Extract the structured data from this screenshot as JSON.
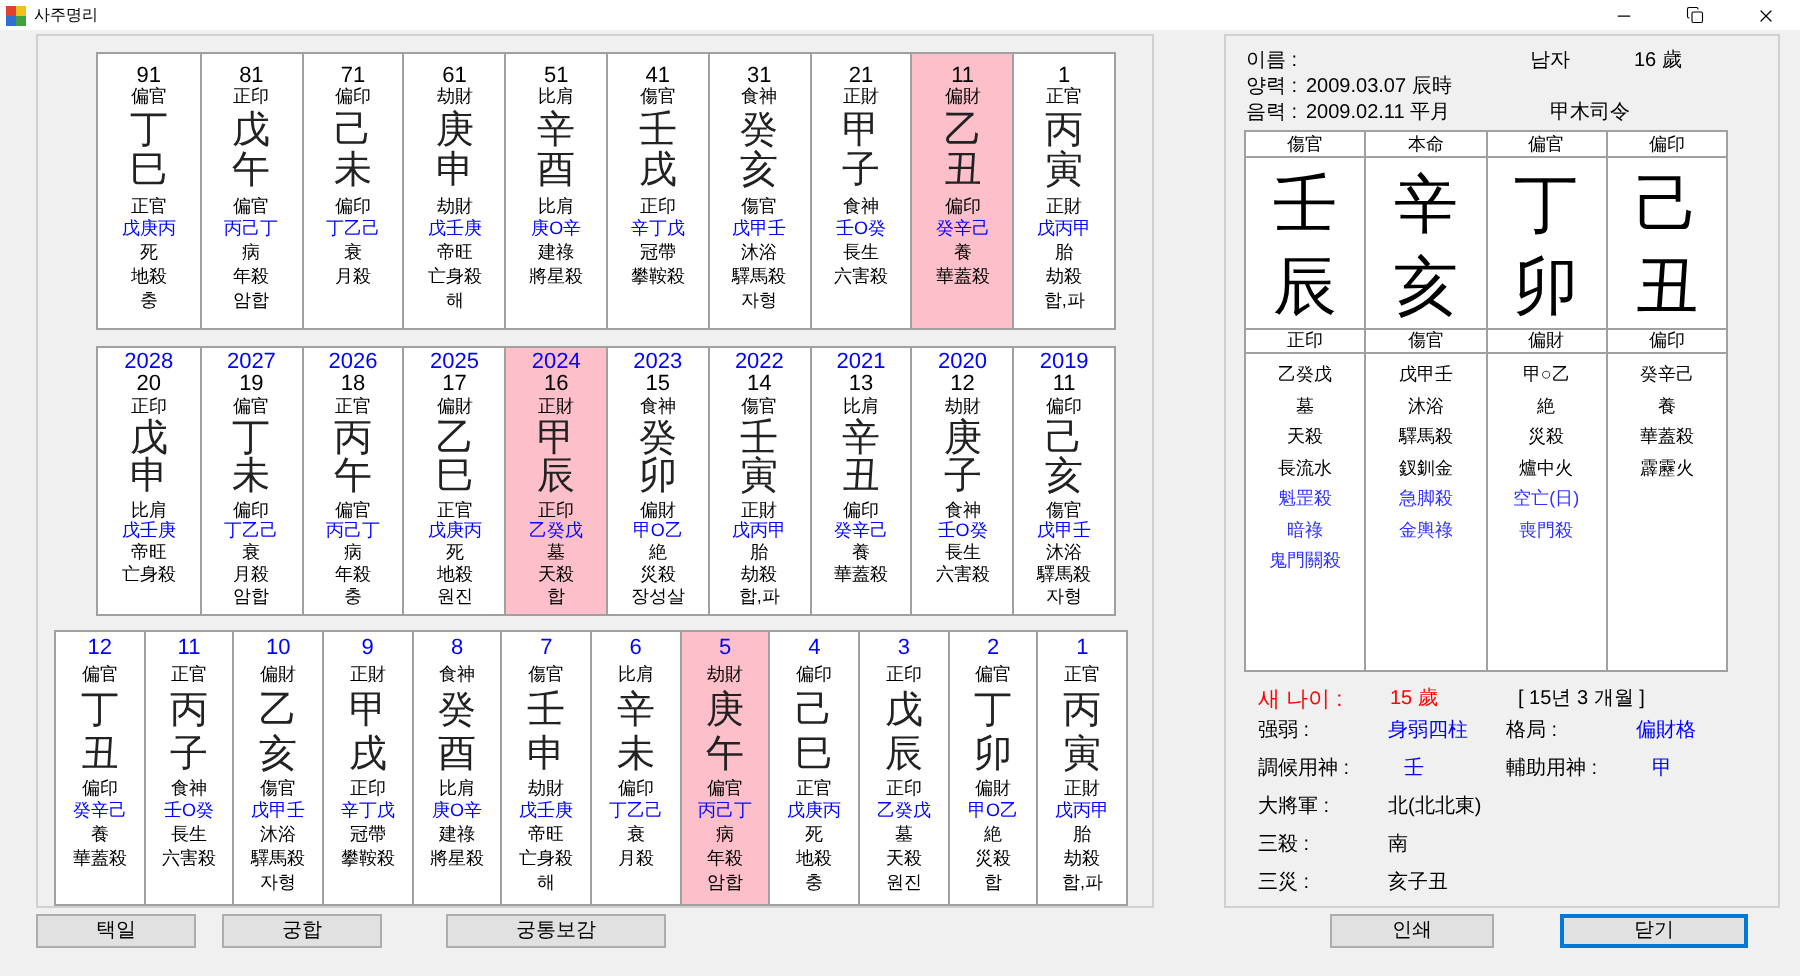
{
  "window": {
    "title": "사주명리"
  },
  "major_luck": [
    {
      "age": "91",
      "god_top": "偏官",
      "stem": "丁",
      "branch": "巳",
      "god_bottom": "正官",
      "hidden": "戊庚丙",
      "stage": "死",
      "sal": "地殺",
      "relation": "충",
      "selected": false
    },
    {
      "age": "81",
      "god_top": "正印",
      "stem": "戊",
      "branch": "午",
      "god_bottom": "偏官",
      "hidden": "丙己丁",
      "stage": "病",
      "sal": "年殺",
      "relation": "암합",
      "selected": false
    },
    {
      "age": "71",
      "god_top": "偏印",
      "stem": "己",
      "branch": "未",
      "god_bottom": "偏印",
      "hidden": "丁乙己",
      "stage": "衰",
      "sal": "月殺",
      "selected": false
    },
    {
      "age": "61",
      "god_top": "劫財",
      "stem": "庚",
      "branch": "申",
      "god_bottom": "劫財",
      "hidden": "戊壬庚",
      "stage": "帝旺",
      "sal": "亡身殺",
      "relation": "해",
      "selected": false
    },
    {
      "age": "51",
      "god_top": "比肩",
      "stem": "辛",
      "branch": "酉",
      "god_bottom": "比肩",
      "hidden": "庚O辛",
      "stage": "建祿",
      "sal": "將星殺",
      "selected": false
    },
    {
      "age": "41",
      "god_top": "傷官",
      "stem": "壬",
      "branch": "戌",
      "god_bottom": "正印",
      "hidden": "辛丁戊",
      "stage": "冠帶",
      "sal": "攀鞍殺",
      "selected": false
    },
    {
      "age": "31",
      "god_top": "食神",
      "stem": "癸",
      "branch": "亥",
      "god_bottom": "傷官",
      "hidden": "戊甲壬",
      "stage": "沐浴",
      "sal": "驛馬殺",
      "relation": "자형",
      "selected": false
    },
    {
      "age": "21",
      "god_top": "正財",
      "stem": "甲",
      "branch": "子",
      "god_bottom": "食神",
      "hidden": "壬O癸",
      "stage": "長生",
      "sal": "六害殺",
      "selected": false
    },
    {
      "age": "11",
      "god_top": "偏財",
      "stem": "乙",
      "branch": "丑",
      "god_bottom": "偏印",
      "hidden": "癸辛己",
      "stage": "養",
      "sal": "華蓋殺",
      "selected": true
    },
    {
      "age": "1",
      "god_top": "正官",
      "stem": "丙",
      "branch": "寅",
      "god_bottom": "正財",
      "hidden": "戊丙甲",
      "stage": "胎",
      "sal": "劫殺",
      "relation": "합,파",
      "selected": false
    }
  ],
  "yearly_luck": [
    {
      "year": "2028",
      "age": "20",
      "god_top": "正印",
      "stem": "戊",
      "branch": "申",
      "god_bottom": "比肩",
      "hidden": "戊壬庚",
      "stage": "帝旺",
      "sal": "亡身殺",
      "selected": false
    },
    {
      "year": "2027",
      "age": "19",
      "god_top": "偏官",
      "stem": "丁",
      "branch": "未",
      "god_bottom": "偏印",
      "hidden": "丁乙己",
      "stage": "衰",
      "sal": "月殺",
      "relation": "암합",
      "selected": false
    },
    {
      "year": "2026",
      "age": "18",
      "god_top": "正官",
      "stem": "丙",
      "branch": "午",
      "god_bottom": "偏官",
      "hidden": "丙己丁",
      "stage": "病",
      "sal": "年殺",
      "relation": "충",
      "selected": false
    },
    {
      "year": "2025",
      "age": "17",
      "god_top": "偏財",
      "stem": "乙",
      "branch": "巳",
      "god_bottom": "正官",
      "hidden": "戊庚丙",
      "stage": "死",
      "sal": "地殺",
      "relation": "원진",
      "selected": false
    },
    {
      "year": "2024",
      "age": "16",
      "god_top": "正財",
      "stem": "甲",
      "branch": "辰",
      "god_bottom": "正印",
      "hidden": "乙癸戊",
      "stage": "墓",
      "sal": "天殺",
      "relation": "합",
      "selected": true
    },
    {
      "year": "2023",
      "age": "15",
      "god_top": "食神",
      "stem": "癸",
      "branch": "卯",
      "god_bottom": "偏財",
      "hidden": "甲O乙",
      "stage": "絶",
      "sal": "災殺",
      "relation": "장성살",
      "selected": false
    },
    {
      "year": "2022",
      "age": "14",
      "god_top": "傷官",
      "stem": "壬",
      "branch": "寅",
      "god_bottom": "正財",
      "hidden": "戊丙甲",
      "stage": "胎",
      "sal": "劫殺",
      "relation": "합,파",
      "selected": false
    },
    {
      "year": "2021",
      "age": "13",
      "god_top": "比肩",
      "stem": "辛",
      "branch": "丑",
      "god_bottom": "偏印",
      "hidden": "癸辛己",
      "stage": "養",
      "sal": "華蓋殺",
      "selected": false
    },
    {
      "year": "2020",
      "age": "12",
      "god_top": "劫財",
      "stem": "庚",
      "branch": "子",
      "god_bottom": "食神",
      "hidden": "壬O癸",
      "stage": "長生",
      "sal": "六害殺",
      "selected": false
    },
    {
      "year": "2019",
      "age": "11",
      "god_top": "偏印",
      "stem": "己",
      "branch": "亥",
      "god_bottom": "傷官",
      "hidden": "戊甲壬",
      "stage": "沐浴",
      "sal": "驛馬殺",
      "relation": "자형",
      "selected": false
    }
  ],
  "monthly_luck": [
    {
      "month": "12",
      "god_top": "偏官",
      "stem": "丁",
      "branch": "丑",
      "god_bottom": "偏印",
      "hidden": "癸辛己",
      "stage": "養",
      "sal": "華蓋殺",
      "selected": false
    },
    {
      "month": "11",
      "god_top": "正官",
      "stem": "丙",
      "branch": "子",
      "god_bottom": "食神",
      "hidden": "壬O癸",
      "stage": "長生",
      "sal": "六害殺",
      "selected": false
    },
    {
      "month": "10",
      "god_top": "偏財",
      "stem": "乙",
      "branch": "亥",
      "god_bottom": "傷官",
      "hidden": "戊甲壬",
      "stage": "沐浴",
      "sal": "驛馬殺",
      "relation": "자형",
      "selected": false
    },
    {
      "month": "9",
      "god_top": "正財",
      "stem": "甲",
      "branch": "戌",
      "god_bottom": "正印",
      "hidden": "辛丁戊",
      "stage": "冠帶",
      "sal": "攀鞍殺",
      "selected": false
    },
    {
      "month": "8",
      "god_top": "食神",
      "stem": "癸",
      "branch": "酉",
      "god_bottom": "比肩",
      "hidden": "庚O辛",
      "stage": "建祿",
      "sal": "將星殺",
      "selected": false
    },
    {
      "month": "7",
      "god_top": "傷官",
      "stem": "壬",
      "branch": "申",
      "god_bottom": "劫財",
      "hidden": "戊壬庚",
      "stage": "帝旺",
      "sal": "亡身殺",
      "relation": "해",
      "selected": false
    },
    {
      "month": "6",
      "god_top": "比肩",
      "stem": "辛",
      "branch": "未",
      "god_bottom": "偏印",
      "hidden": "丁乙己",
      "stage": "衰",
      "sal": "月殺",
      "selected": false
    },
    {
      "month": "5",
      "god_top": "劫財",
      "stem": "庚",
      "branch": "午",
      "god_bottom": "偏官",
      "hidden": "丙己丁",
      "stage": "病",
      "sal": "年殺",
      "relation": "암합",
      "selected": true
    },
    {
      "month": "4",
      "god_top": "偏印",
      "stem": "己",
      "branch": "巳",
      "god_bottom": "正官",
      "hidden": "戊庚丙",
      "stage": "死",
      "sal": "地殺",
      "relation": "충",
      "selected": false
    },
    {
      "month": "3",
      "god_top": "正印",
      "stem": "戊",
      "branch": "辰",
      "god_bottom": "正印",
      "hidden": "乙癸戊",
      "stage": "墓",
      "sal": "天殺",
      "relation": "원진",
      "selected": false
    },
    {
      "month": "2",
      "god_top": "偏官",
      "stem": "丁",
      "branch": "卯",
      "god_bottom": "偏財",
      "hidden": "甲O乙",
      "stage": "絶",
      "sal": "災殺",
      "relation": "합",
      "selected": false
    },
    {
      "month": "1",
      "god_top": "正官",
      "stem": "丙",
      "branch": "寅",
      "god_bottom": "正財",
      "hidden": "戊丙甲",
      "stage": "胎",
      "sal": "劫殺",
      "relation": "합,파",
      "selected": false
    }
  ],
  "profile": {
    "name_label": "이름 :",
    "gender": "남자",
    "age": "16 歲",
    "solar_label": "양력 :",
    "solar_date": "2009.03.07 辰時",
    "lunar_label": "음력 :",
    "lunar_date": "2009.02.11 平月",
    "commander": "甲木司令"
  },
  "natal_chart": [
    {
      "god_top": "傷官",
      "stem": "壬",
      "branch": "辰",
      "god_bottom": "正印",
      "lines": [
        {
          "text": "乙癸戊",
          "kind": "plain"
        },
        {
          "text": "墓",
          "kind": "plain"
        },
        {
          "text": "天殺",
          "kind": "plain"
        },
        {
          "text": "長流水",
          "kind": "plain"
        },
        {
          "text": "魁罡殺",
          "kind": "special"
        },
        {
          "text": "暗祿",
          "kind": "special"
        },
        {
          "text": "鬼門關殺",
          "kind": "special"
        }
      ]
    },
    {
      "god_top": "本命",
      "stem": "辛",
      "branch": "亥",
      "god_bottom": "傷官",
      "lines": [
        {
          "text": "戊甲壬",
          "kind": "plain"
        },
        {
          "text": "沐浴",
          "kind": "plain"
        },
        {
          "text": "驛馬殺",
          "kind": "plain"
        },
        {
          "text": "釵釧金",
          "kind": "plain"
        },
        {
          "text": "急脚殺",
          "kind": "special"
        },
        {
          "text": "金輿祿",
          "kind": "special"
        }
      ]
    },
    {
      "god_top": "偏官",
      "stem": "丁",
      "branch": "卯",
      "god_bottom": "偏財",
      "lines": [
        {
          "text": "甲○乙",
          "kind": "plain"
        },
        {
          "text": "絶",
          "kind": "plain"
        },
        {
          "text": "災殺",
          "kind": "plain"
        },
        {
          "text": "爐中火",
          "kind": "plain"
        },
        {
          "text": "空亡(日)",
          "kind": "special"
        },
        {
          "text": "喪門殺",
          "kind": "special"
        }
      ]
    },
    {
      "god_top": "偏印",
      "stem": "己",
      "branch": "丑",
      "god_bottom": "偏印",
      "lines": [
        {
          "text": "癸辛己",
          "kind": "plain"
        },
        {
          "text": "養",
          "kind": "plain"
        },
        {
          "text": "華蓋殺",
          "kind": "plain"
        },
        {
          "text": "霹靂火",
          "kind": "plain"
        }
      ]
    }
  ],
  "new_age": {
    "label": "새 나이 :",
    "value": "15 歲",
    "duration": "[ 15년 3 개월 ]"
  },
  "summary_rows": [
    {
      "items": [
        {
          "label": "强弱 :",
          "value": "身弱四柱",
          "highlighted": true
        },
        {
          "label": "格局 :",
          "value": "偏財格",
          "highlighted": true
        }
      ]
    },
    {
      "items": [
        {
          "label": "調候用神 :",
          "value": "壬",
          "highlighted": true
        },
        {
          "label": "輔助用神 :",
          "value": "甲",
          "highlighted": true
        }
      ]
    },
    {
      "items": [
        {
          "label": "大將軍 :",
          "value": "北(北北東)",
          "highlighted": false
        }
      ]
    },
    {
      "items": [
        {
          "label": "三殺 :",
          "value": "南",
          "highlighted": false
        }
      ]
    },
    {
      "items": [
        {
          "label": "三災 :",
          "value": "亥子丑",
          "highlighted": false
        }
      ]
    }
  ],
  "left_buttons": [
    {
      "label": "택일",
      "focused": false
    },
    {
      "label": "궁합",
      "focused": false
    },
    {
      "label": "궁통보감",
      "focused": false
    }
  ],
  "right_buttons": [
    {
      "label": "인쇄",
      "focused": false
    },
    {
      "label": "닫기",
      "focused": true
    }
  ]
}
